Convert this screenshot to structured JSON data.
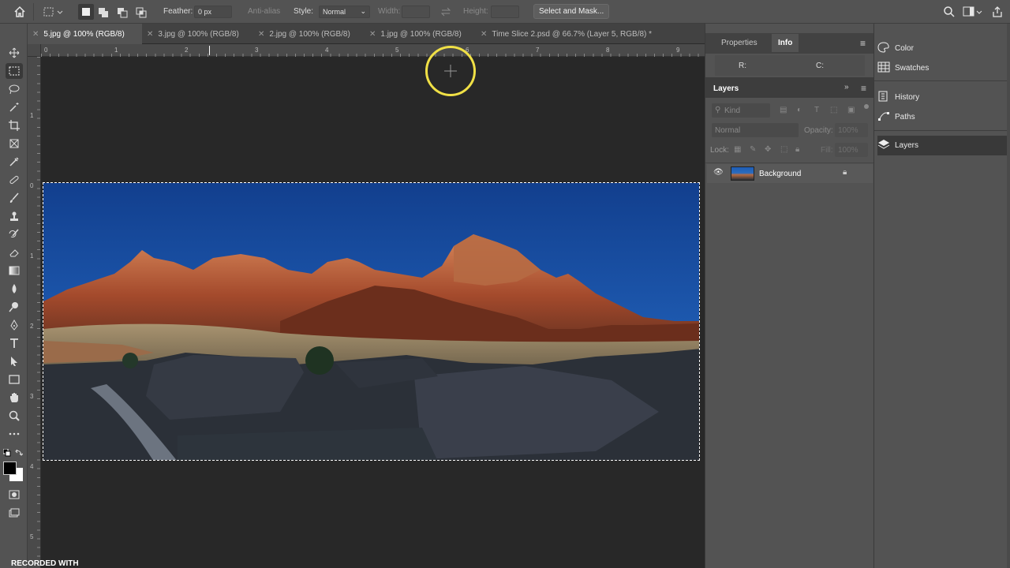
{
  "options_bar": {
    "feather_label": "Feather:",
    "feather_value": "0 px",
    "anti_alias_label": "Anti-alias",
    "style_label": "Style:",
    "style_value": "Normal",
    "width_label": "Width:",
    "height_label": "Height:",
    "select_mask_label": "Select and Mask..."
  },
  "tabs": [
    {
      "label": "5.jpg @ 100% (RGB/8)",
      "active": true
    },
    {
      "label": "3.jpg @ 100% (RGB/8)",
      "active": false
    },
    {
      "label": "2.jpg @ 100% (RGB/8)",
      "active": false
    },
    {
      "label": "1.jpg @ 100% (RGB/8)",
      "active": false
    },
    {
      "label": "Time Slice 2.psd @ 66.7% (Layer 5, RGB/8) *",
      "active": false
    }
  ],
  "rulers": {
    "h": [
      "0",
      "1",
      "2",
      "3",
      "4",
      "5",
      "6",
      "7",
      "8",
      "9"
    ],
    "v": [
      "1",
      "0",
      "1",
      "2",
      "3",
      "4",
      "5"
    ]
  },
  "properties_panel": {
    "tab_properties": "Properties",
    "tab_info": "Info",
    "r_label": "R:",
    "c_label": "C:"
  },
  "layers_panel": {
    "title": "Layers",
    "kind_placeholder": "Kind",
    "blend_mode": "Normal",
    "opacity_label": "Opacity:",
    "opacity_value": "100%",
    "lock_label": "Lock:",
    "fill_label": "Fill:",
    "fill_value": "100%",
    "layers": [
      {
        "name": "Background",
        "visible": true,
        "locked": true
      }
    ]
  },
  "side_panels": {
    "color": "Color",
    "swatches": "Swatches",
    "history": "History",
    "paths": "Paths",
    "layers": "Layers"
  },
  "watermark": "RECORDED WITH",
  "colors": {
    "accent_cursor": "#f0e046",
    "panel_bg": "#535353",
    "canvas_bg": "#282828"
  }
}
